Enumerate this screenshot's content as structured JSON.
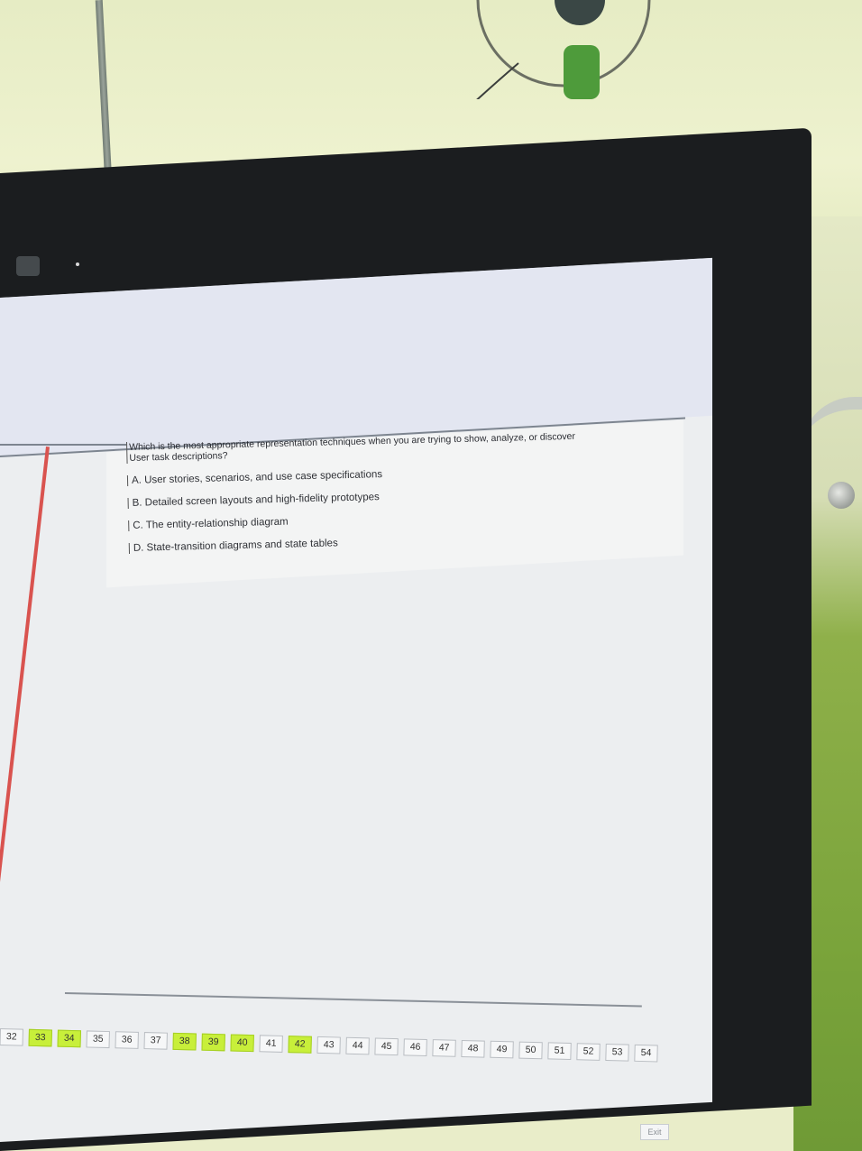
{
  "question": {
    "text_line1": "Which is the most appropriate representation techniques when you are trying to show, analyze, or discover",
    "text_line2": "User task descriptions?",
    "options": [
      {
        "label": "A.",
        "text": "User stories, scenarios, and use case specifications"
      },
      {
        "label": "B.",
        "text": "Detailed screen layouts and high-fidelity prototypes"
      },
      {
        "label": "C.",
        "text": "The entity-relationship diagram"
      },
      {
        "label": "D.",
        "text": "State-transition diagrams and state tables"
      }
    ]
  },
  "navigation": {
    "numbers": [
      "32",
      "33",
      "34",
      "35",
      "36",
      "37",
      "38",
      "39",
      "40",
      "41",
      "42",
      "43",
      "44",
      "45",
      "46",
      "47",
      "48",
      "49",
      "50",
      "51",
      "52",
      "53",
      "54"
    ],
    "answered": [
      "33",
      "34",
      "38",
      "39",
      "40",
      "42"
    ]
  },
  "exit_label": "Exit"
}
